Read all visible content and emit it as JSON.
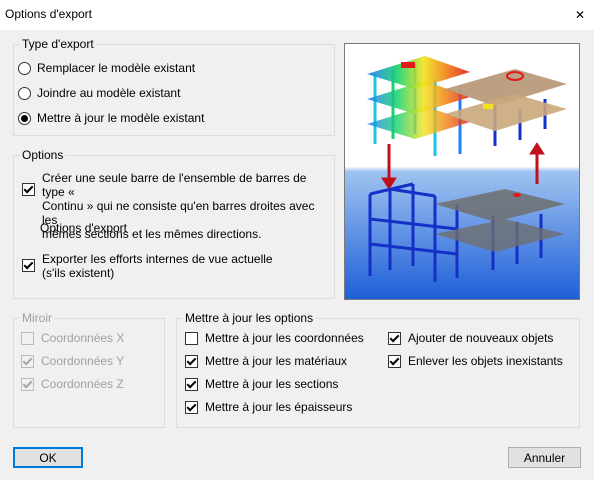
{
  "window": {
    "title": "Options d'export"
  },
  "export_type": {
    "label": "Type d'export",
    "options": [
      {
        "label": "Remplacer le modèle existant",
        "checked": false
      },
      {
        "label": "Joindre au modèle existant",
        "checked": false
      },
      {
        "label": "Mettre à jour le modèle existant",
        "checked": true
      }
    ]
  },
  "options": {
    "label": "Options",
    "single_bar": {
      "label": "Créer une seule barre de l'ensemble de barres de type «\nContinu » qui ne consiste qu'en barres droites avec les\nmêmes sections et les mêmes directions.",
      "checked": true
    },
    "export_options_label": "Options d'export",
    "export_forces": {
      "label": "Exporter les efforts internes de vue actuelle\n(s'ils existent)",
      "checked": true
    }
  },
  "mirror": {
    "label": "Miroir",
    "items": [
      {
        "label": "Coordonnées X",
        "checked": false
      },
      {
        "label": "Coordonnées Y",
        "checked": true
      },
      {
        "label": "Coordonnées Z",
        "checked": true
      }
    ]
  },
  "update_options": {
    "label": "Mettre à jour les options",
    "left": [
      {
        "label": "Mettre à jour les coordonnées",
        "checked": false
      },
      {
        "label": "Mettre à jour les matériaux",
        "checked": true
      },
      {
        "label": "Mettre à jour les sections",
        "checked": true
      },
      {
        "label": "Mettre à jour les épaisseurs",
        "checked": true
      }
    ],
    "right": [
      {
        "label": "Ajouter de nouveaux objets",
        "checked": true
      },
      {
        "label": "Enlever les objets inexistants",
        "checked": true
      }
    ]
  },
  "buttons": {
    "ok": "OK",
    "cancel": "Annuler"
  },
  "colors": {
    "accent": "#0078d7",
    "arrow": "#c0111a",
    "structure_blue": "#1430c8"
  }
}
